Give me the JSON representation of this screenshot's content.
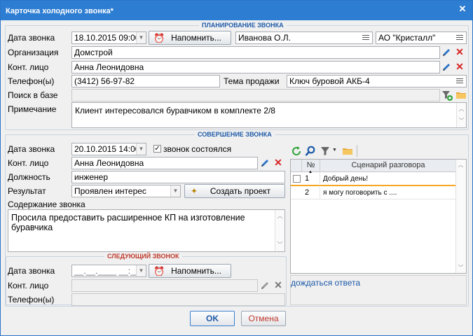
{
  "window": {
    "title": "Карточка холодного звонка*"
  },
  "plan": {
    "section_title": "ПЛАНИРОВАНИЕ ЗВОНКА",
    "date_label": "Дата звонка",
    "date_value": "18.10.2015 09:00",
    "remind_label": "Напомнить...",
    "manager_value": "Иванова О.Л.",
    "company_value": "АО \"Кристалл\"",
    "org_label": "Организация",
    "org_value": "Домстрой",
    "contact_label": "Конт. лицо",
    "contact_value": "Анна Леонидовна",
    "phone_label": "Телефон(ы)",
    "phone_value": "(3412) 56-97-82",
    "topic_label": "Тема продажи",
    "topic_value": "Ключ буровой АКБ-4",
    "search_label": "Поиск в базе",
    "note_label": "Примечание",
    "note_value": "Клиент интересовался буравчиком в комплекте 2/8"
  },
  "done": {
    "section_title": "СОВЕРШЕНИЕ ЗВОНКА",
    "date_label": "Дата звонка",
    "date_value": "20.10.2015 14:00",
    "happened_label": "звонок состоялся",
    "contact_label": "Конт. лицо",
    "contact_value": "Анна Леонидовна",
    "position_label": "Должность",
    "position_value": "инженер",
    "result_label": "Результат",
    "result_value": "Проявлен интерес",
    "create_project_label": "Создать проект",
    "content_label": "Содержание звонка",
    "content_value": "Просила предоставить расширенное КП на изготовление буравчика"
  },
  "next": {
    "section_title": "СЛЕДУЮЩИЙ ЗВОНОК",
    "date_label": "Дата звонка",
    "date_value": "__.__.____ __:__",
    "remind_label": "Напомнить...",
    "contact_label": "Конт. лицо",
    "phone_label": "Телефон(ы)"
  },
  "script": {
    "col_num": "№",
    "col_script": "Сценарий разговора",
    "rows": [
      {
        "num": "1",
        "text": "Добрый день!"
      },
      {
        "num": "2",
        "text": "я могу поговорить с ...."
      }
    ],
    "detail_text": "дождаться ответа"
  },
  "footer": {
    "ok_label": "OK",
    "cancel_label": "Отмена"
  },
  "colors": {
    "title_bar": "#2d7dd2",
    "section_title": "#1e5aa8",
    "next_section_title": "#c0392b",
    "grid_select": "#f5a623"
  }
}
